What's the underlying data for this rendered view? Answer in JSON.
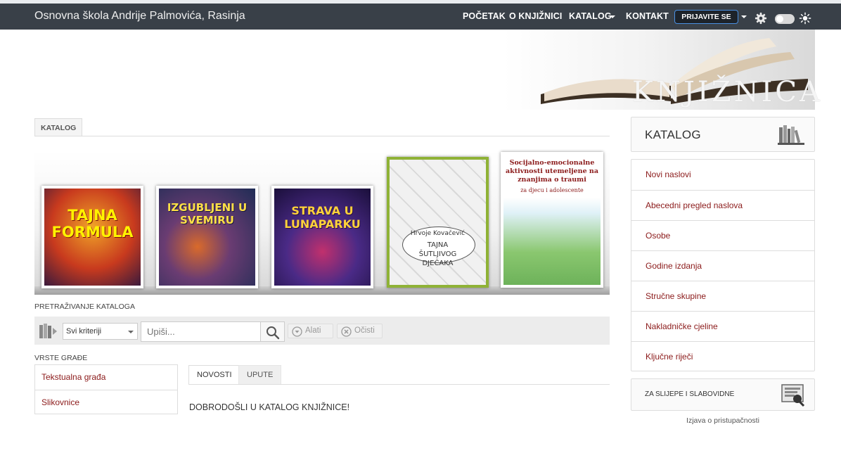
{
  "header": {
    "site_title": "Osnovna škola Andrije Palmovića, Rasinja",
    "nav": [
      "POČETAK",
      "O KNJIŽNICI",
      "KATALOG",
      "KONTAKT"
    ],
    "login_label": "PRIJAVITE SE"
  },
  "banner": {
    "text": "KNJIŽNICA"
  },
  "catalog_tab": "KATALOG",
  "books": [
    {
      "title": "TAJNA FORMULA",
      "color": "#c83a1e"
    },
    {
      "title": "IZGUBLJENI U SVEMIRU",
      "color": "#2b3a6b"
    },
    {
      "title": "STRAVA U LUNAPARKU",
      "color": "#3a1d66"
    },
    {
      "title": "Hrvoje Kovačević",
      "subtitle": "TAJNA ŠUTLJIVOG DJEČAKA",
      "color": "#8fb236"
    },
    {
      "title": "Socijalno-emocionalne aktivnosti utemeljene na znanjima o traumi",
      "subtitle": "za djecu i adolescente",
      "color": "#ffffff"
    }
  ],
  "search": {
    "section_label": "PRETRAŽIVANJE KATALOGA",
    "criteria": "Svi kriteriji",
    "placeholder": "Upiši...",
    "tools_label": "Alati",
    "clear_label": "Očisti"
  },
  "material_types": {
    "label": "VRSTE GRAĐE",
    "items": [
      "Tekstualna građa",
      "Slikovnice"
    ]
  },
  "content_tabs": [
    "NOVOSTI",
    "UPUTE"
  ],
  "welcome": "DOBRODOŠLI U KATALOG KNJIŽNICE!",
  "sidebar": {
    "title": "KATALOG",
    "items": [
      "Novi naslovi",
      "Abecedni pregled naslova",
      "Osobe",
      "Godine izdanja",
      "Stručne skupine",
      "Nakladničke cjeline",
      "Ključne riječi"
    ],
    "blind_label": "ZA SLIJEPE I SLABOVIDNE",
    "accessibility_link": "Izjava o pristupačnosti"
  }
}
